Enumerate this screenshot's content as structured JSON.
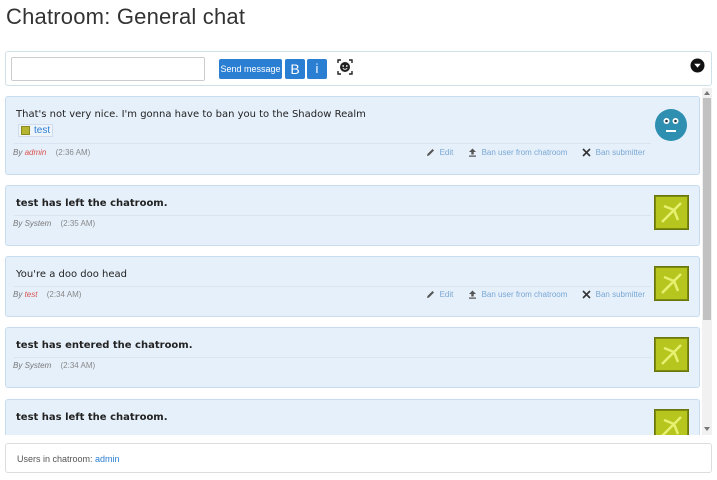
{
  "page": {
    "title": "Chatroom: General chat"
  },
  "composer": {
    "message_value": "",
    "send_label": "Send message",
    "bold_label": "B",
    "italic_label": "i"
  },
  "actions": {
    "edit": "Edit",
    "ban_user": "Ban user from chatroom",
    "ban_submitter": "Ban submitter"
  },
  "messages": [
    {
      "text": "That's not very nice. I'm gonna have to ban you to the Shadow Realm",
      "by": "By",
      "author": "admin",
      "time": "(2:36 AM)",
      "attachment": "test",
      "system": false
    },
    {
      "text": "test has left the chatroom.",
      "by": "By",
      "author": "System",
      "time": "(2:35 AM)",
      "system": true
    },
    {
      "text": "You're a doo doo head",
      "by": "By",
      "author": "test",
      "time": "(2:34 AM)",
      "system": false
    },
    {
      "text": "test has entered the chatroom.",
      "by": "By",
      "author": "System",
      "time": "(2:34 AM)",
      "system": true
    },
    {
      "text": "test has left the chatroom.",
      "system": true
    }
  ],
  "users": {
    "label": "Users in chatroom:",
    "names": "admin"
  },
  "colors": {
    "accent": "#2b7fd3",
    "message_bg": "#e6f0fb",
    "author": "#d9534f",
    "avatar_face": "#2e8fb0"
  }
}
